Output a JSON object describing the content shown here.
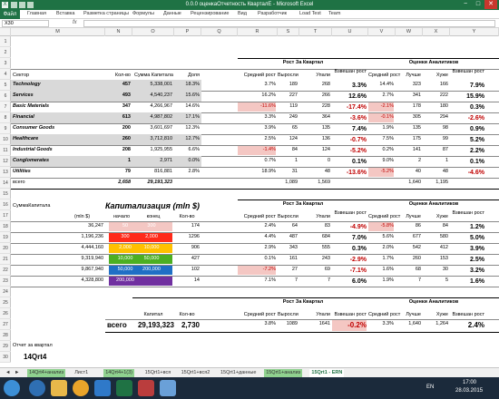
{
  "window": {
    "title": "0.0.0 оценкаОтчетность КварталЕ - Microsoft Excel",
    "min": "−",
    "max": "□",
    "close": "✕"
  },
  "ribbon": {
    "file": "Файл",
    "tabs": [
      "Главная",
      "Вставка",
      "Разметка страницы",
      "Формулы",
      "Данные",
      "Рецензирование",
      "Вид",
      "Разработчик",
      "Load Test",
      "Team"
    ]
  },
  "formula": {
    "namebox": "X30",
    "fx": "fx",
    "value": ""
  },
  "columns": [
    "M",
    "N",
    "O",
    "P",
    "Q",
    "R",
    "S",
    "T",
    "U",
    "V",
    "W",
    "X",
    "Y"
  ],
  "rows": [
    "1",
    "2",
    "3",
    "4",
    "5",
    "6",
    "7",
    "8",
    "9",
    "10",
    "11",
    "12",
    "13",
    "14",
    "15",
    "16",
    "17",
    "18",
    "19",
    "20",
    "21",
    "22",
    "23",
    "24",
    "25",
    "26",
    "27",
    "28",
    "29",
    "30"
  ],
  "table1": {
    "header_group1": "Рост За Квартал",
    "header_group2": "Оценки Аналитиков",
    "cols": {
      "sector": "Сектор",
      "count": "Кол-во",
      "sum": "Сумма Капитала",
      "share": "Доля",
      "avg": "Средний рост",
      "up": "Выросли",
      "down": "Упали",
      "weighted": "Взвешан рост",
      "avg2": "Средний рост",
      "better": "Лучше",
      "worse": "Хуже",
      "weighted2": "Взвешан рост"
    },
    "rows": [
      {
        "sector": "Technology",
        "count": "457",
        "sum": "5,338,001",
        "share": "18.3%",
        "avg": "3.7%",
        "up": "189",
        "down": "268",
        "w": "3.3%",
        "avg2": "14.4%",
        "better": "323",
        "worse": "166",
        "w2": "7.9%",
        "gray": true
      },
      {
        "sector": "Services",
        "count": "493",
        "sum": "4,540,237",
        "share": "15.6%",
        "avg": "16.2%",
        "up": "227",
        "down": "266",
        "w": "12.6%",
        "avg2": "2.7%",
        "better": "341",
        "worse": "222",
        "w2": "15.9%",
        "gray": true
      },
      {
        "sector": "Basic Materials",
        "count": "347",
        "sum": "4,266,967",
        "share": "14.6%",
        "avg": "-11.6%",
        "up": "119",
        "down": "228",
        "w": "-17.4%",
        "avg2": "-2.1%",
        "better": "178",
        "worse": "180",
        "w2": "0.3%",
        "gray": false
      },
      {
        "sector": "Financial",
        "count": "613",
        "sum": "4,987,802",
        "share": "17.1%",
        "avg": "3.3%",
        "up": "249",
        "down": "364",
        "w": "-3.6%",
        "avg2": "-0.1%",
        "better": "305",
        "worse": "294",
        "w2": "-2.6%",
        "gray": true
      },
      {
        "sector": "Consumer Goods",
        "count": "200",
        "sum": "3,601,697",
        "share": "12.3%",
        "avg": "3.9%",
        "up": "65",
        "down": "135",
        "w": "7.4%",
        "avg2": "1.9%",
        "better": "135",
        "worse": "98",
        "w2": "0.9%",
        "gray": false
      },
      {
        "sector": "Healthcare",
        "count": "260",
        "sum": "3,712,810",
        "share": "12.7%",
        "avg": "2.5%",
        "up": "124",
        "down": "136",
        "w": "-0.7%",
        "avg2": "7.5%",
        "better": "175",
        "worse": "99",
        "w2": "5.2%",
        "gray": true
      },
      {
        "sector": "Industrial Goods",
        "count": "208",
        "sum": "1,925,955",
        "share": "6.6%",
        "avg": "-1.4%",
        "up": "84",
        "down": "124",
        "w": "-5.2%",
        "avg2": "0.2%",
        "better": "141",
        "worse": "87",
        "w2": "2.2%",
        "gray": false
      },
      {
        "sector": "Conglomerates",
        "count": "1",
        "sum": "2,971",
        "share": "0.0%",
        "avg": "0.7%",
        "up": "1",
        "down": "0",
        "w": "0.1%",
        "avg2": "9.0%",
        "better": "2",
        "worse": "1",
        "w2": "0.1%",
        "gray": true
      },
      {
        "sector": "Utilities",
        "count": "79",
        "sum": "816,881",
        "share": "2.8%",
        "avg": "18.9%",
        "up": "31",
        "down": "48",
        "w": "-13.6%",
        "avg2": "-5.2%",
        "better": "40",
        "worse": "48",
        "w2": "-4.6%",
        "gray": false
      }
    ],
    "total": {
      "label": "всего",
      "count": "2,658",
      "sum": "29,193,323",
      "up": "1,089",
      "down": "1,569",
      "better": "1,640",
      "worse": "1,195"
    }
  },
  "table2": {
    "label_left": "СуммаКапитала",
    "title": "Капитализация (mln $)",
    "header_group1": "Рост За Квартал",
    "header_group2": "Оценки Аналитиков",
    "cols": {
      "mln": "(mln $)",
      "start": "начало",
      "end": "конец",
      "count": "Кол-во",
      "avg": "Средний рост",
      "up": "Выросли",
      "down": "Упали",
      "weighted": "Взвешан рост",
      "avg2": "Средний рост",
      "better": "Лучше",
      "worse": "Хуже",
      "weighted2": "Взвешан рост"
    },
    "rows": [
      {
        "cap": "36,247",
        "start": "50",
        "end": "300",
        "count": "174",
        "avg": "2.4%",
        "up": "64",
        "down": "83",
        "w": "-4.9%",
        "avg2": "-5.8%",
        "better": "86",
        "worse": "84",
        "w2": "1.2%",
        "color": "#f4c7c3"
      },
      {
        "cap": "1,196,236",
        "start": "300",
        "end": "2,000",
        "count": "1296",
        "avg": "4.4%",
        "up": "487",
        "down": "684",
        "w": "7.0%",
        "avg2": "5.6%",
        "better": "677",
        "worse": "580",
        "w2": "5.0%",
        "color": "#ff2a1a"
      },
      {
        "cap": "4,444,160",
        "start": "2,000",
        "end": "10,000",
        "count": "906",
        "avg": "2.9%",
        "up": "343",
        "down": "555",
        "w": "0.3%",
        "avg2": "2.0%",
        "better": "542",
        "worse": "412",
        "w2": "3.9%",
        "color": "#ffc000"
      },
      {
        "cap": "9,319,940",
        "start": "10,000",
        "end": "50,000",
        "count": "427",
        "avg": "0.1%",
        "up": "161",
        "down": "243",
        "w": "-2.9%",
        "avg2": "1.7%",
        "better": "260",
        "worse": "153",
        "w2": "2.5%",
        "color": "#4caf22"
      },
      {
        "cap": "9,867,940",
        "start": "50,000",
        "end": "200,000",
        "count": "102",
        "avg": "-7.2%",
        "up": "27",
        "down": "69",
        "w": "-7.1%",
        "avg2": "1.6%",
        "better": "68",
        "worse": "30",
        "w2": "3.2%",
        "color": "#1f6fc5"
      },
      {
        "cap": "4,328,800",
        "start": "200,000",
        "end": "",
        "count": "14",
        "avg": "7.1%",
        "up": "7",
        "down": "7",
        "w": "6.0%",
        "avg2": "1.9%",
        "better": "7",
        "worse": "5",
        "w2": "1.6%",
        "color": "#7030a0"
      }
    ]
  },
  "table3": {
    "header_group1": "Рост За Квартал",
    "header_group2": "Оценки Аналитиков",
    "cols": {
      "cap": "Капитал",
      "count": "Кол-во",
      "avg": "Средний рост",
      "up": "Выросли",
      "down": "Упали",
      "weighted": "Взвешан рост",
      "avg2": "Средний рост",
      "better": "Лучше",
      "worse": "Хуже",
      "weighted2": "Взвешан рост"
    },
    "row": {
      "label": "всего",
      "cap": "29,193,323",
      "count": "2,730",
      "avg": "3.8%",
      "up": "1089",
      "down": "1641",
      "w": "-0.2%",
      "avg2": "3.3%",
      "better": "1,640",
      "worse": "1,264",
      "w2": "2.4%"
    }
  },
  "report": {
    "label": "Отчет за квартал",
    "value": "14Qrt4"
  },
  "sheet_tabs": [
    "14Qrt4+анализ",
    "Лист1",
    "14Qrt4+1(3)",
    "15Qrt1+вся",
    "15Qrt1+вся2",
    "15Qrt1+данные",
    "15Qrt1+анализ",
    "15Qrt1 - ERN"
  ],
  "active_tab": "15Qrt1 - ERN",
  "taskbar": {
    "lang": "EN",
    "time": "17:00",
    "date": "28.03.2015"
  }
}
